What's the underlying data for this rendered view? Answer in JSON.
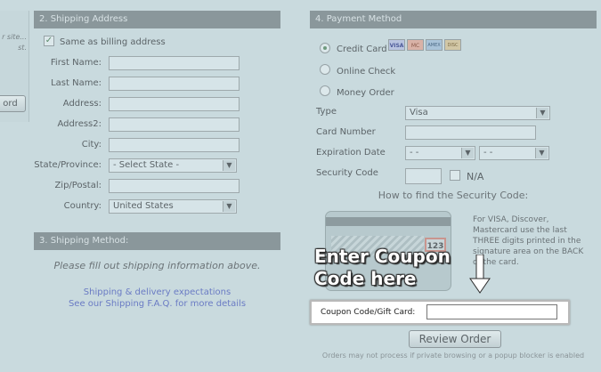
{
  "left_stub": {
    "hint_line1": "r site...",
    "hint_line2": "st.",
    "button_label": "ord"
  },
  "shipping_address": {
    "title": "2. Shipping Address",
    "same_as_billing": "Same as billing address",
    "first_name": "First Name:",
    "last_name": "Last Name:",
    "address": "Address:",
    "address2": "Address2:",
    "city": "City:",
    "state": "State/Province:",
    "state_value": "- Select State -",
    "zip": "Zip/Postal:",
    "country": "Country:",
    "country_value": "United States"
  },
  "shipping_method": {
    "title": "3. Shipping Method:",
    "message": "Please fill out shipping information above.",
    "link1": "Shipping & delivery expectations",
    "link2": "See our Shipping F.A.Q. for more details"
  },
  "payment": {
    "title": "4. Payment Method",
    "credit_card": "Credit Card",
    "online_check": "Online Check",
    "money_order": "Money Order",
    "card_logos": [
      "VISA",
      "MC",
      "AMEX",
      "DISC"
    ],
    "type_label": "Type",
    "type_value": "Visa",
    "card_number_label": "Card Number",
    "expiration_label": "Expiration Date",
    "exp_month": "- -",
    "exp_year": "- -",
    "security_label": "Security Code",
    "na_label": "N/A",
    "how_to_find": "How to find the Security Code:",
    "card_code": "123",
    "security_help": "For VISA, Discover, Mastercard use the last THREE digits printed in the signature area on the BACK of the card.",
    "overlay_line1": "Enter Coupon",
    "overlay_line2": "Code here",
    "coupon_label": "Coupon Code/Gift Card:",
    "review_button": "Review Order",
    "footer_note": "Orders may not process if private browsing or a popup blocker is enabled"
  },
  "colors": {
    "background": "#c9dade",
    "panel_header": "#8a979b",
    "link": "#6a7bc4"
  }
}
